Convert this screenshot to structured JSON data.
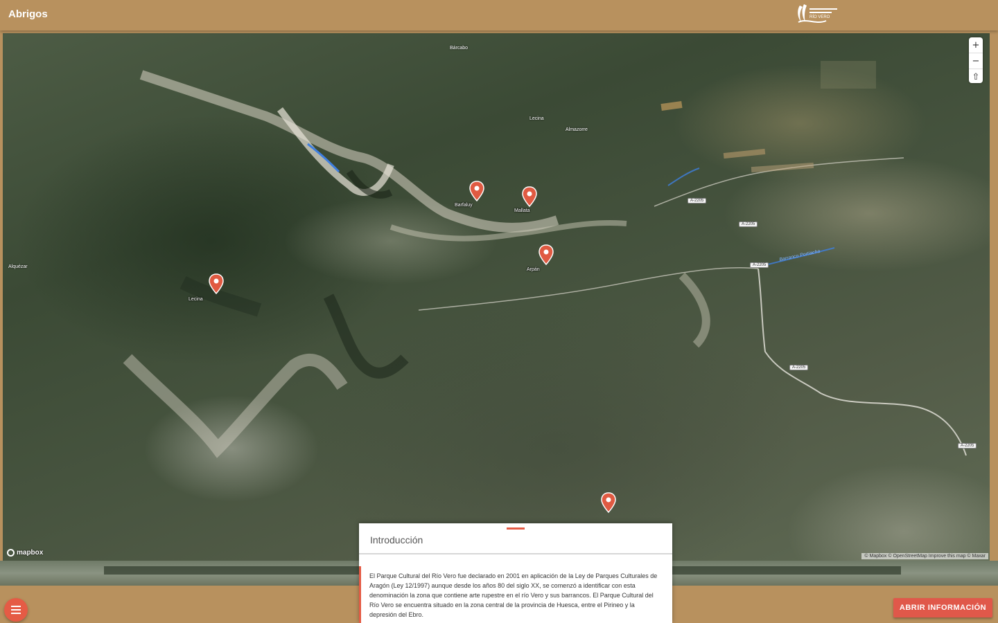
{
  "app": {
    "title": "Abrigos",
    "logo_icon": "parque-cultural-rio-vero-logo",
    "logo_text": "RÍO VERO"
  },
  "map": {
    "attribution": "© Mapbox © OpenStreetMap Improve this map © Maxar",
    "mapbox_logo": "mapbox",
    "markers": [
      {
        "id": "abrigo-1",
        "label": "Barfaluy"
      },
      {
        "id": "abrigo-2",
        "label": "Mallata"
      },
      {
        "id": "abrigo-3",
        "label": "Arpán"
      },
      {
        "id": "abrigo-4",
        "label": "Lecina"
      },
      {
        "id": "abrigo-5",
        "label": ""
      }
    ],
    "places": [
      {
        "id": "town-1",
        "label": "Bárcabo"
      },
      {
        "id": "town-2",
        "label": "Almazorre"
      },
      {
        "id": "town-3",
        "label": "Lecina"
      },
      {
        "id": "town-4",
        "label": "Alquézar"
      }
    ],
    "roads": [
      "A-2205",
      "A-2205",
      "A-2205",
      "A-2205",
      "A-2205"
    ],
    "river_label": "Barranco Portiacha",
    "accent_color": "#e55b45",
    "marker_color": "#e05a42"
  },
  "controls": {
    "zoom_in": "+",
    "zoom_out": "−",
    "compass": "⇧"
  },
  "bottom": {
    "menu_icon": "hamburger-menu-icon",
    "open_info_label": "ABRIR INFORMACIÓN"
  },
  "info": {
    "title": "Introducción",
    "body": "El Parque Cultural del Río Vero fue declarado en 2001 en aplicación de la Ley de Parques Culturales de Aragón (Ley 12/1997) aunque desde los años 80 del siglo XX, se comenzó a identificar con esta denominación la zona que contiene arte rupestre en el río Vero y sus barrancos. El Parque Cultural del Río Vero se encuentra situado en la zona central de la provincia de Huesca, entre el Pirineo y la depresión del Ebro."
  },
  "colors": {
    "header": "#b8915e",
    "button": "#e0584a"
  }
}
